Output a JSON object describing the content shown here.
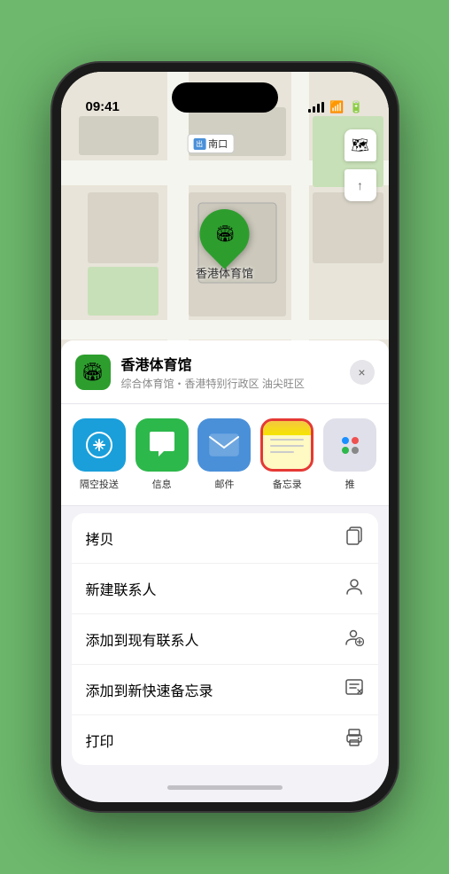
{
  "statusBar": {
    "time": "09:41",
    "locationArrow": "▶"
  },
  "mapControls": {
    "mapIcon": "🗺",
    "compassIcon": "⬆"
  },
  "marker": {
    "label": "香港体育馆"
  },
  "mapLabel": {
    "prefix": "南口",
    "tagText": "出"
  },
  "locationCard": {
    "name": "香港体育馆",
    "desc": "综合体育馆・香港特别行政区 油尖旺区",
    "closeLabel": "×"
  },
  "shareItems": [
    {
      "id": "airdrop",
      "label": "隔空投送",
      "type": "airdrop"
    },
    {
      "id": "messages",
      "label": "信息",
      "type": "message"
    },
    {
      "id": "mail",
      "label": "邮件",
      "type": "mail"
    },
    {
      "id": "notes",
      "label": "备忘录",
      "type": "notes"
    },
    {
      "id": "more",
      "label": "推",
      "type": "more"
    }
  ],
  "actions": [
    {
      "label": "拷贝",
      "icon": "📋"
    },
    {
      "label": "新建联系人",
      "icon": "👤"
    },
    {
      "label": "添加到现有联系人",
      "icon": "👤"
    },
    {
      "label": "添加到新快速备忘录",
      "icon": "📓"
    },
    {
      "label": "打印",
      "icon": "🖨"
    }
  ]
}
